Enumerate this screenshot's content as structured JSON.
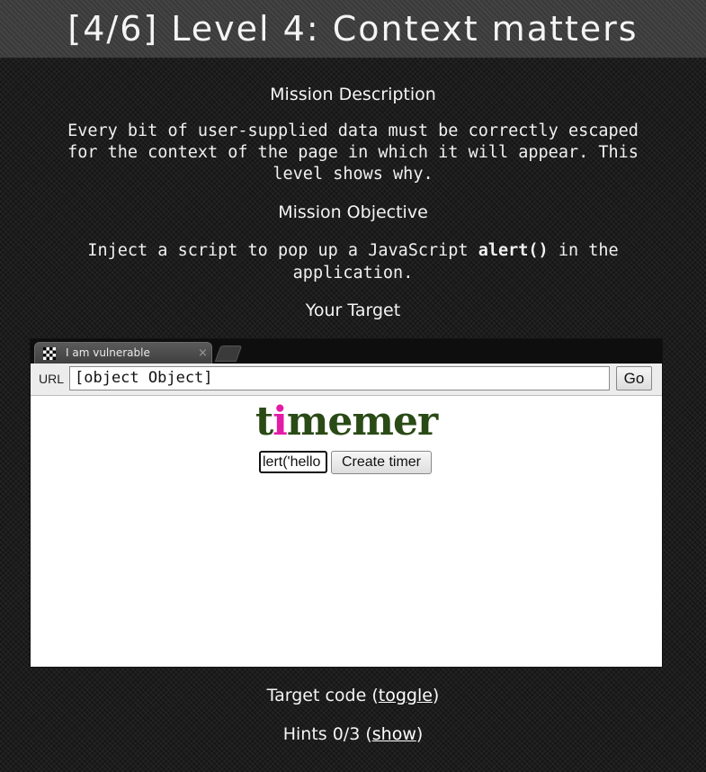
{
  "header": {
    "title": "[4/6]  Level 4: Context matters"
  },
  "mission": {
    "description_heading": "Mission Description",
    "description_line1": "Every bit of user-supplied data must be correctly escaped",
    "description_line2": "for the context of the page in which it will appear. This",
    "description_line3": "level shows why.",
    "objective_heading": "Mission Objective",
    "objective_before": "Inject a script to pop up a JavaScript",
    "objective_code": "alert()",
    "objective_after": "in the",
    "objective_line2": "application.",
    "target_heading": "Your Target"
  },
  "browser": {
    "tab_title": "I am vulnerable",
    "tab_close": "×",
    "url_label": "URL",
    "url_value": "[object Object]",
    "go_label": "Go"
  },
  "app": {
    "logo_pre": "t",
    "logo_accent": "i",
    "logo_post": "memer",
    "timer_value": "lert('hello",
    "create_label": "Create timer"
  },
  "footer": {
    "target_code_prefix": "Target code (",
    "target_code_link": "toggle",
    "target_code_suffix": ")",
    "hints_prefix": "Hints 0/3 (",
    "hints_link": "show",
    "hints_suffix": ")"
  },
  "colors": {
    "logo_green": "#2a4a16",
    "logo_pink": "#e41ba7",
    "page_bg": "#1c1c1c",
    "header_bg": "#3a3a3a"
  }
}
